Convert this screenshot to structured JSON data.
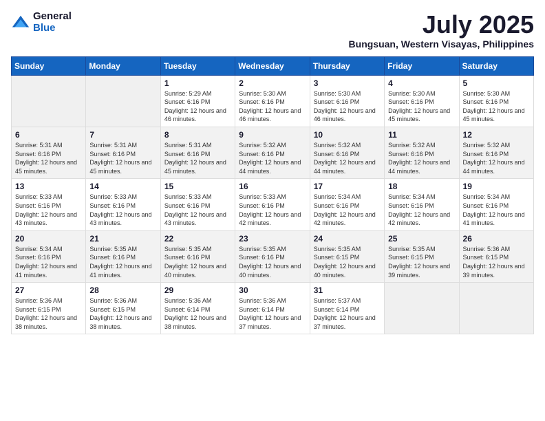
{
  "logo": {
    "general": "General",
    "blue": "Blue"
  },
  "title": "July 2025",
  "subtitle": "Bungsuan, Western Visayas, Philippines",
  "headers": [
    "Sunday",
    "Monday",
    "Tuesday",
    "Wednesday",
    "Thursday",
    "Friday",
    "Saturday"
  ],
  "weeks": [
    [
      {
        "day": "",
        "info": ""
      },
      {
        "day": "",
        "info": ""
      },
      {
        "day": "1",
        "info": "Sunrise: 5:29 AM\nSunset: 6:16 PM\nDaylight: 12 hours and 46 minutes."
      },
      {
        "day": "2",
        "info": "Sunrise: 5:30 AM\nSunset: 6:16 PM\nDaylight: 12 hours and 46 minutes."
      },
      {
        "day": "3",
        "info": "Sunrise: 5:30 AM\nSunset: 6:16 PM\nDaylight: 12 hours and 46 minutes."
      },
      {
        "day": "4",
        "info": "Sunrise: 5:30 AM\nSunset: 6:16 PM\nDaylight: 12 hours and 45 minutes."
      },
      {
        "day": "5",
        "info": "Sunrise: 5:30 AM\nSunset: 6:16 PM\nDaylight: 12 hours and 45 minutes."
      }
    ],
    [
      {
        "day": "6",
        "info": "Sunrise: 5:31 AM\nSunset: 6:16 PM\nDaylight: 12 hours and 45 minutes."
      },
      {
        "day": "7",
        "info": "Sunrise: 5:31 AM\nSunset: 6:16 PM\nDaylight: 12 hours and 45 minutes."
      },
      {
        "day": "8",
        "info": "Sunrise: 5:31 AM\nSunset: 6:16 PM\nDaylight: 12 hours and 45 minutes."
      },
      {
        "day": "9",
        "info": "Sunrise: 5:32 AM\nSunset: 6:16 PM\nDaylight: 12 hours and 44 minutes."
      },
      {
        "day": "10",
        "info": "Sunrise: 5:32 AM\nSunset: 6:16 PM\nDaylight: 12 hours and 44 minutes."
      },
      {
        "day": "11",
        "info": "Sunrise: 5:32 AM\nSunset: 6:16 PM\nDaylight: 12 hours and 44 minutes."
      },
      {
        "day": "12",
        "info": "Sunrise: 5:32 AM\nSunset: 6:16 PM\nDaylight: 12 hours and 44 minutes."
      }
    ],
    [
      {
        "day": "13",
        "info": "Sunrise: 5:33 AM\nSunset: 6:16 PM\nDaylight: 12 hours and 43 minutes."
      },
      {
        "day": "14",
        "info": "Sunrise: 5:33 AM\nSunset: 6:16 PM\nDaylight: 12 hours and 43 minutes."
      },
      {
        "day": "15",
        "info": "Sunrise: 5:33 AM\nSunset: 6:16 PM\nDaylight: 12 hours and 43 minutes."
      },
      {
        "day": "16",
        "info": "Sunrise: 5:33 AM\nSunset: 6:16 PM\nDaylight: 12 hours and 42 minutes."
      },
      {
        "day": "17",
        "info": "Sunrise: 5:34 AM\nSunset: 6:16 PM\nDaylight: 12 hours and 42 minutes."
      },
      {
        "day": "18",
        "info": "Sunrise: 5:34 AM\nSunset: 6:16 PM\nDaylight: 12 hours and 42 minutes."
      },
      {
        "day": "19",
        "info": "Sunrise: 5:34 AM\nSunset: 6:16 PM\nDaylight: 12 hours and 41 minutes."
      }
    ],
    [
      {
        "day": "20",
        "info": "Sunrise: 5:34 AM\nSunset: 6:16 PM\nDaylight: 12 hours and 41 minutes."
      },
      {
        "day": "21",
        "info": "Sunrise: 5:35 AM\nSunset: 6:16 PM\nDaylight: 12 hours and 41 minutes."
      },
      {
        "day": "22",
        "info": "Sunrise: 5:35 AM\nSunset: 6:16 PM\nDaylight: 12 hours and 40 minutes."
      },
      {
        "day": "23",
        "info": "Sunrise: 5:35 AM\nSunset: 6:16 PM\nDaylight: 12 hours and 40 minutes."
      },
      {
        "day": "24",
        "info": "Sunrise: 5:35 AM\nSunset: 6:15 PM\nDaylight: 12 hours and 40 minutes."
      },
      {
        "day": "25",
        "info": "Sunrise: 5:35 AM\nSunset: 6:15 PM\nDaylight: 12 hours and 39 minutes."
      },
      {
        "day": "26",
        "info": "Sunrise: 5:36 AM\nSunset: 6:15 PM\nDaylight: 12 hours and 39 minutes."
      }
    ],
    [
      {
        "day": "27",
        "info": "Sunrise: 5:36 AM\nSunset: 6:15 PM\nDaylight: 12 hours and 38 minutes."
      },
      {
        "day": "28",
        "info": "Sunrise: 5:36 AM\nSunset: 6:15 PM\nDaylight: 12 hours and 38 minutes."
      },
      {
        "day": "29",
        "info": "Sunrise: 5:36 AM\nSunset: 6:14 PM\nDaylight: 12 hours and 38 minutes."
      },
      {
        "day": "30",
        "info": "Sunrise: 5:36 AM\nSunset: 6:14 PM\nDaylight: 12 hours and 37 minutes."
      },
      {
        "day": "31",
        "info": "Sunrise: 5:37 AM\nSunset: 6:14 PM\nDaylight: 12 hours and 37 minutes."
      },
      {
        "day": "",
        "info": ""
      },
      {
        "day": "",
        "info": ""
      }
    ]
  ]
}
